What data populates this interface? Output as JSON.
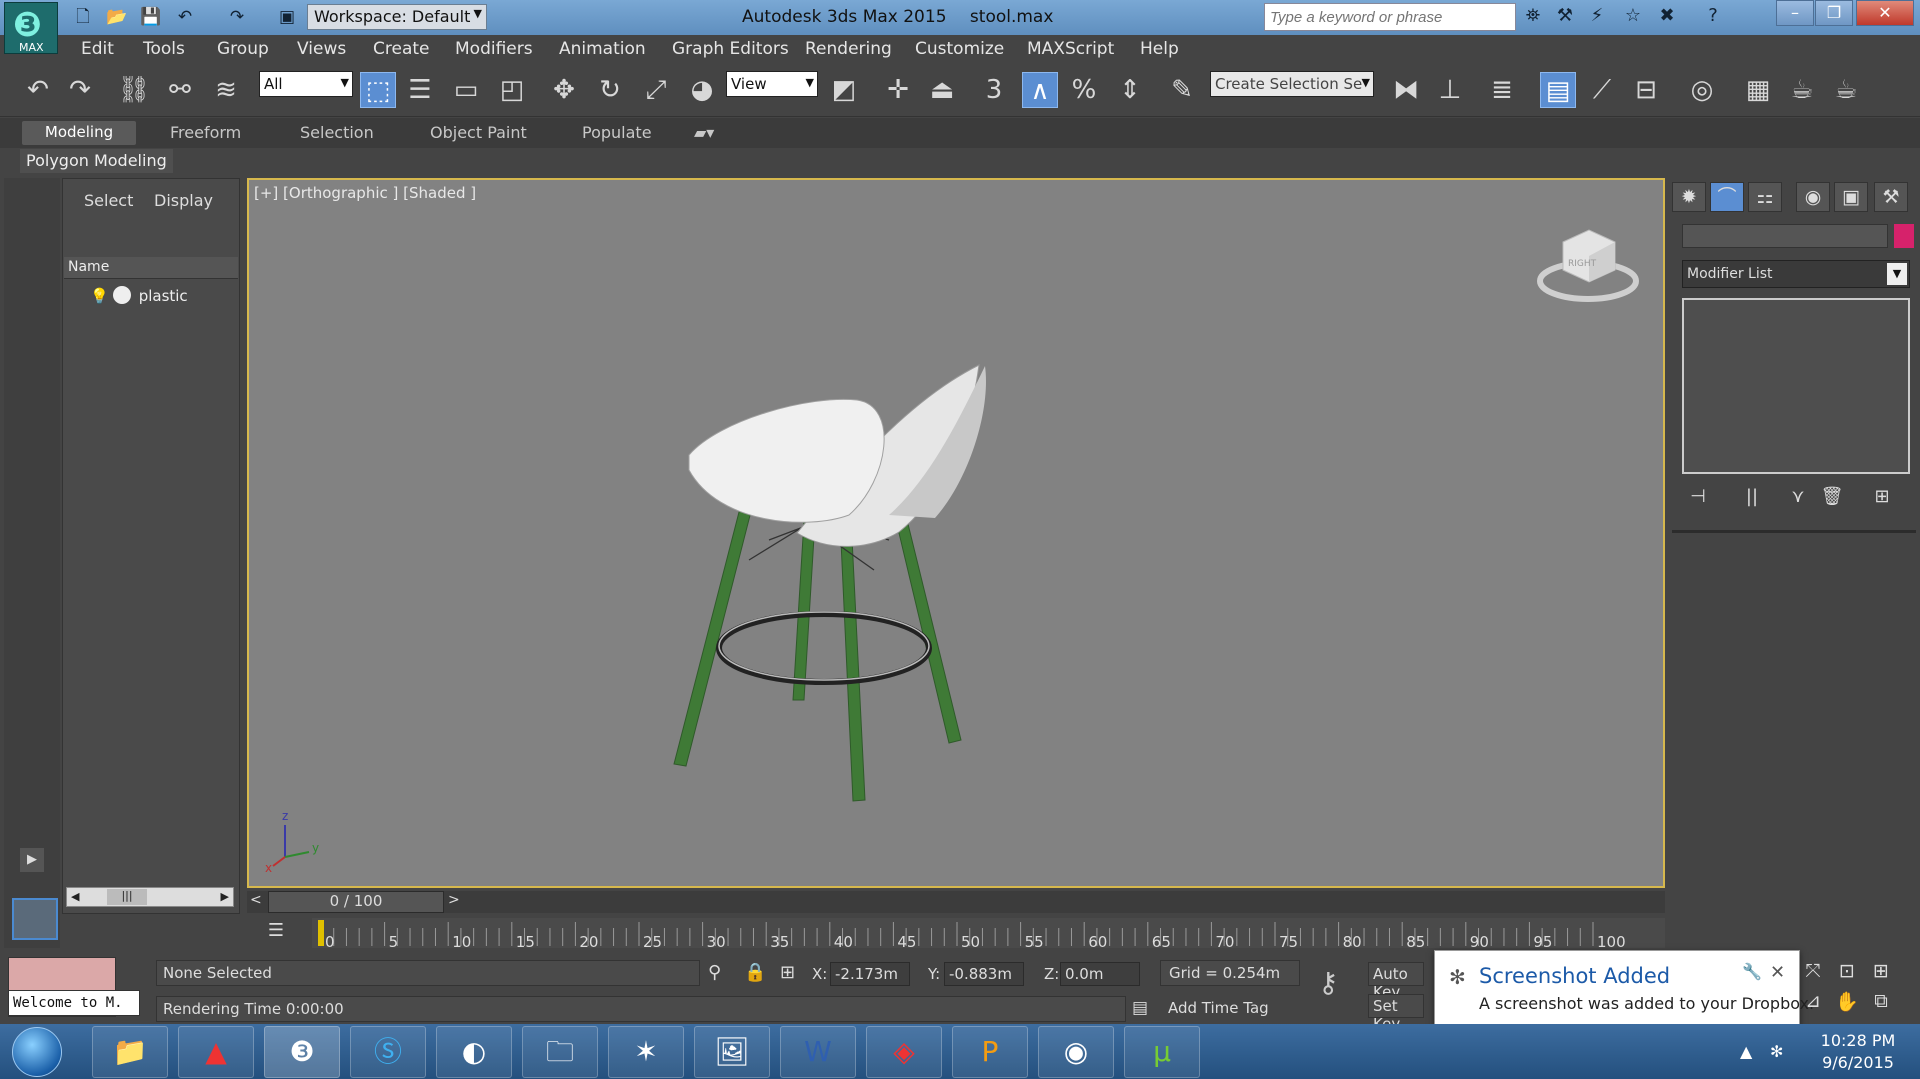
{
  "title_bar": {
    "app_logo_label": "MAX",
    "workspace": "Workspace: Default",
    "app_name": "Autodesk 3ds Max  2015",
    "file_name": "stool.max",
    "search_placeholder": "Type a keyword or phrase"
  },
  "menu": [
    "Edit",
    "Tools",
    "Group",
    "Views",
    "Create",
    "Modifiers",
    "Animation",
    "Graph Editors",
    "Rendering",
    "Customize",
    "MAXScript",
    "Help"
  ],
  "toolbar": {
    "selection_filter": "All",
    "reference_coord": "View",
    "snap_number": "3",
    "named_selection_placeholder": "Create Selection Se"
  },
  "ribbon": {
    "tabs": [
      "Modeling",
      "Freeform",
      "Selection",
      "Object Paint",
      "Populate"
    ],
    "panel_label": "Polygon Modeling"
  },
  "scene_explorer": {
    "tabs": [
      "Select",
      "Display"
    ],
    "column_header": "Name",
    "objects": [
      {
        "name": "plastic"
      }
    ]
  },
  "viewport": {
    "label": "[+] [Orthographic ] [Shaded ]",
    "viewcube_face": "RIGHT",
    "axis_labels": {
      "x": "x",
      "y": "y",
      "z": "z"
    }
  },
  "command_panel": {
    "modifier_list": "Modifier List",
    "object_color": "#d6226b"
  },
  "timeline": {
    "current": "0 / 100",
    "ticks": [
      "0",
      "5",
      "10",
      "15",
      "20",
      "25",
      "30",
      "35",
      "40",
      "45",
      "50",
      "55",
      "60",
      "65",
      "70",
      "75",
      "80",
      "85",
      "90",
      "95",
      "100"
    ]
  },
  "status": {
    "listener_text": "Welcome to M.",
    "selection": "None Selected",
    "prompt": "Rendering Time  0:00:00",
    "x_label": "X:",
    "x_value": "-2.173m",
    "y_label": "Y:",
    "y_value": "-0.883m",
    "z_label": "Z:",
    "z_value": "0.0m",
    "grid": "Grid = 0.254m",
    "add_time_tag": "Add Time Tag",
    "auto_key": "Auto Key",
    "set_key": "Set Key"
  },
  "notification": {
    "title": "Screenshot Added",
    "message": "A screenshot was added to your Dropbox."
  },
  "taskbar": {
    "time": "10:28 PM",
    "date": "9/6/2015"
  }
}
